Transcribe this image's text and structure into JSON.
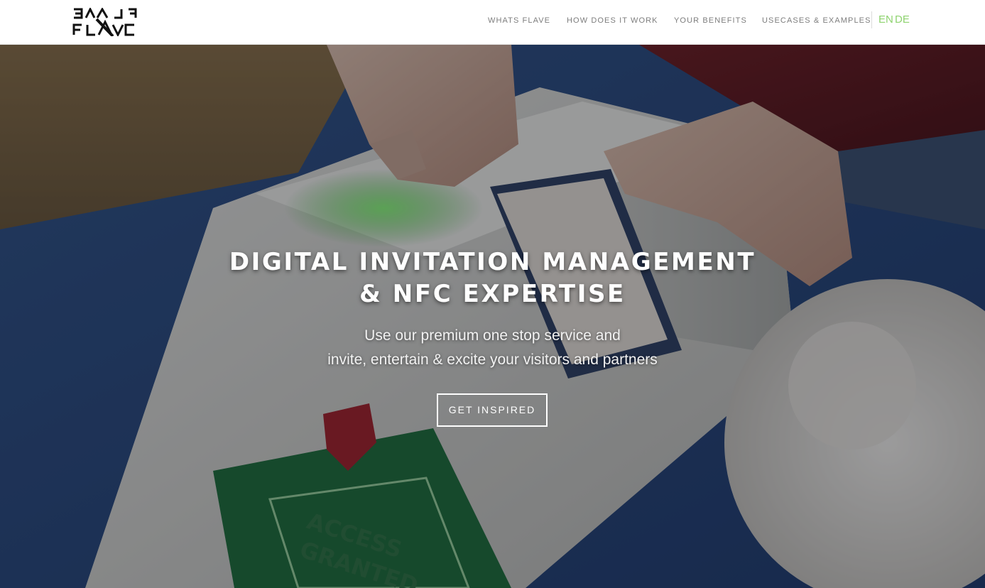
{
  "brand": {
    "name": "FLAVE"
  },
  "nav": {
    "items": [
      {
        "label": "WHATS FLAVE"
      },
      {
        "label": "HOW DOES IT WORK"
      },
      {
        "label": "YOUR BENEFITS"
      },
      {
        "label": "USECASES & EXAMPLES"
      }
    ],
    "languages": [
      "EN",
      "DE"
    ],
    "language_color": "#8ed36f"
  },
  "hero": {
    "title_line1": "DIGITAL INVITATION MANAGEMENT",
    "title_line2": "& NFC EXPERTISE",
    "subtitle_line1": "Use our premium one stop service and",
    "subtitle_line2": "invite, entertain & excite your visitors and partners",
    "cta_label": "GET INSPIRED",
    "badge_text_line1": "ACCESS",
    "badge_text_line2": "GRANTED",
    "background": "photo of hands tapping an NFC badge on a white scanner with green glow"
  }
}
